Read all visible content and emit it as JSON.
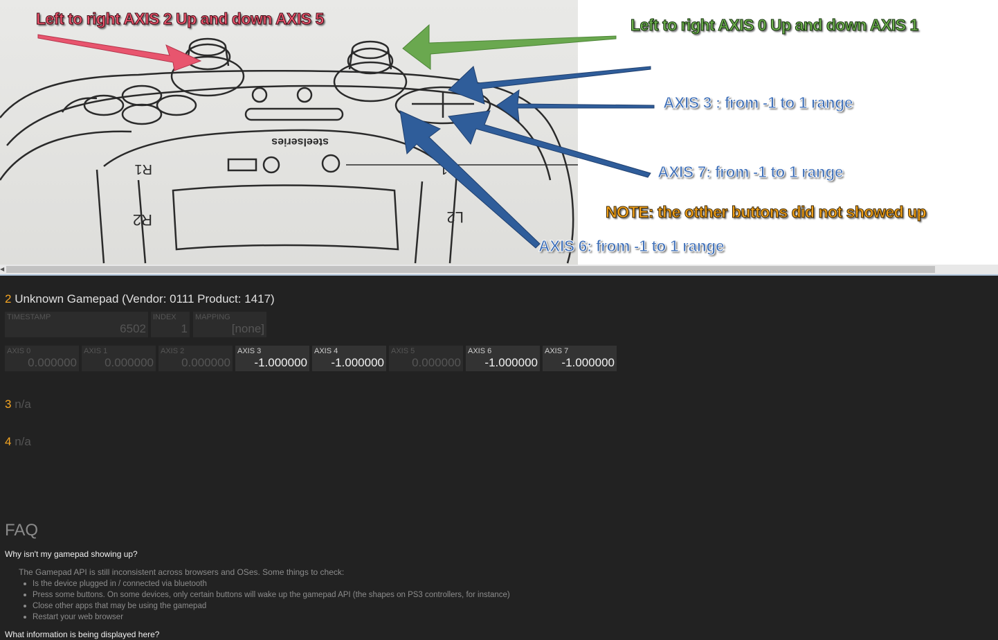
{
  "annotations": {
    "left_stick": "Left  to   right  AXIS  2    Up  and  down   AXIS 5",
    "right_stick": "Left  to  right   AXIS  0     Up  and  down   AXIS 1",
    "axis3": "AXIS 3 :  from  -1     to  1  range",
    "axis7": "AXIS 7: from  -1  to  1  range",
    "note": "NOTE: the otther buttons did not showed up",
    "axis6": "AXIS 6: from  -1  to  1  range"
  },
  "controller_markings": {
    "r1": "R1",
    "r2": "R2",
    "l1": "L1",
    "l2": "L2",
    "brand": "steelseries"
  },
  "colors": {
    "accent": "#f5a623",
    "background": "#222222",
    "panel": "#2c2c2c"
  },
  "gamepad": {
    "slot": "2",
    "name": "Unknown Gamepad (Vendor: 0111 Product: 1417)",
    "timestamp": {
      "label": "TIMESTAMP",
      "value": "6502"
    },
    "index": {
      "label": "INDEX",
      "value": "1"
    },
    "mapping": {
      "label": "MAPPING",
      "value": "[none]"
    },
    "axes": [
      {
        "label": "AXIS 0",
        "value": "0.000000"
      },
      {
        "label": "AXIS 1",
        "value": "0.000000"
      },
      {
        "label": "AXIS 2",
        "value": "0.000000"
      },
      {
        "label": "AXIS 3",
        "value": "-1.000000"
      },
      {
        "label": "AXIS 4",
        "value": "-1.000000"
      },
      {
        "label": "AXIS 5",
        "value": "0.000000"
      },
      {
        "label": "AXIS 6",
        "value": "-1.000000"
      },
      {
        "label": "AXIS 7",
        "value": "-1.000000"
      }
    ]
  },
  "slots": [
    {
      "num": "3",
      "text": "n/a"
    },
    {
      "num": "4",
      "text": "n/a"
    }
  ],
  "faq": {
    "title": "FAQ",
    "q1": "Why isn't my gamepad showing up?",
    "intro": "The Gamepad API is still inconsistent across browsers and OSes. Some things to check:",
    "items": [
      "Is the device plugged in / connected via bluetooth",
      "Press some buttons. On some devices, only certain buttons will wake up the gamepad API (the shapes on PS3 controllers, for instance)",
      "Close other apps that may be using the gamepad",
      "Restart your web browser"
    ],
    "q2": "What information is being displayed here?"
  }
}
